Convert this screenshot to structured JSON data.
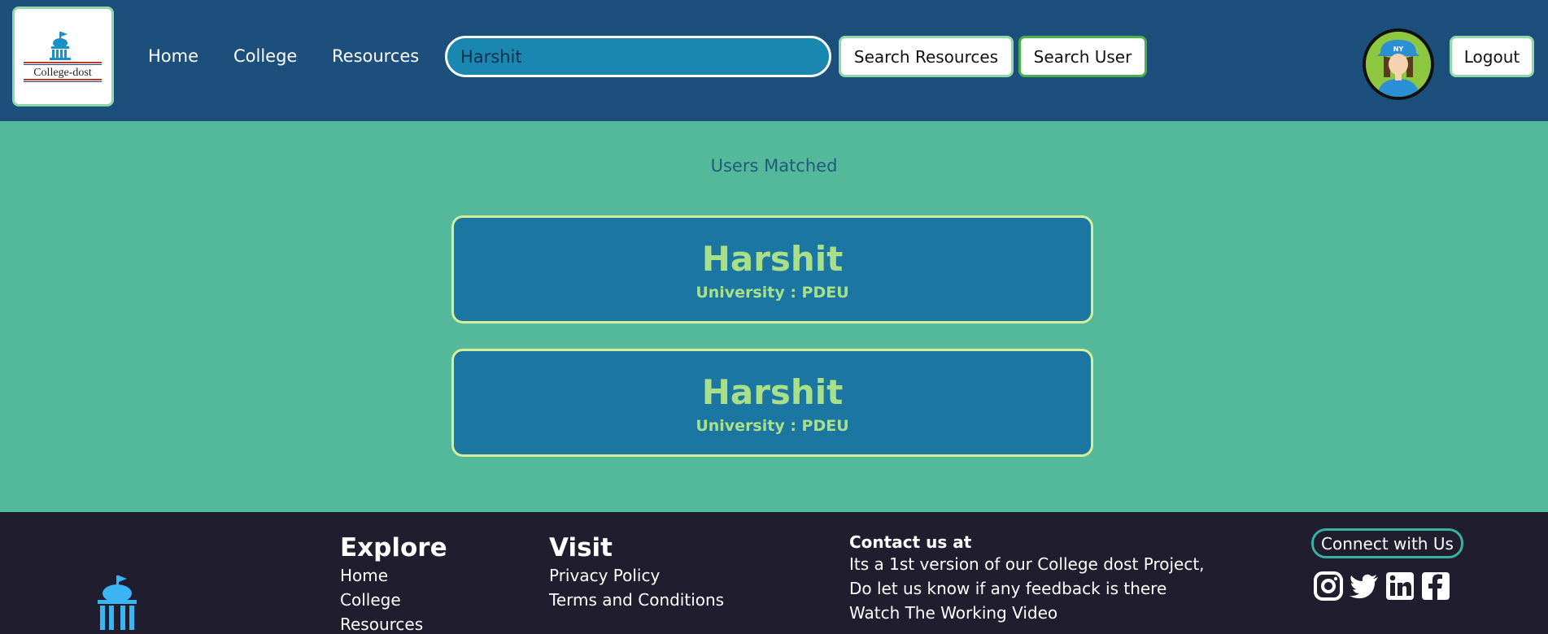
{
  "header": {
    "logo_text": "College-dost",
    "nav": {
      "home": "Home",
      "college": "College",
      "resources": "Resources"
    },
    "search": {
      "value": "Harshit"
    },
    "search_resources_label": "Search Resources",
    "search_user_label": "Search User",
    "logout_label": "Logout",
    "avatar_cap_text": "NY"
  },
  "main": {
    "heading": "Users Matched",
    "results": [
      {
        "name": "Harshit",
        "university": "University : PDEU"
      },
      {
        "name": "Harshit",
        "university": "University : PDEU"
      }
    ]
  },
  "footer": {
    "explore": {
      "title": "Explore",
      "links": [
        "Home",
        "College",
        "Resources"
      ]
    },
    "visit": {
      "title": "Visit",
      "links": [
        "Privacy Policy",
        "Terms and Conditions"
      ]
    },
    "contact": {
      "title": "Contact us at",
      "lines": [
        "Its a 1st version of our College dost Project,",
        "Do let us know if any feedback is there",
        "Watch The Working Video"
      ]
    },
    "connect_label": "Connect with Us",
    "social_icons": [
      "instagram-icon",
      "twitter-icon",
      "linkedin-icon",
      "facebook-icon"
    ]
  },
  "colors": {
    "header_bg": "#1c4f7b",
    "main_bg": "#54b89a",
    "card_bg": "#1b76a1",
    "card_text": "#a8e08a",
    "footer_bg": "#1f1d2e"
  }
}
